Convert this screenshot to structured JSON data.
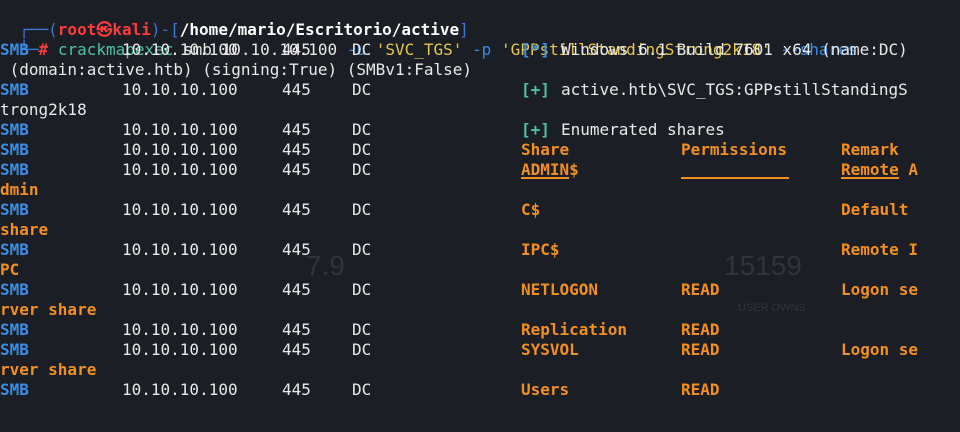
{
  "prompt": {
    "top_prefix": "┌──(",
    "user": "root",
    "skull": "㉿",
    "host": "kali",
    "sep": ")-[",
    "path": "/home/mario/Escritorio/active",
    "close": "]",
    "bottom_prefix": "└─",
    "hash": "#"
  },
  "command": {
    "binary": "crackmapexec",
    "proto": " smb 10.10.10.100 ",
    "u_flag": "-u",
    "user": "'SVC_TGS'",
    "p_flag": "-p",
    "pass": "'GPPstillStandingStrong2k18'",
    "shares_flag": "--shares"
  },
  "smb": {
    "proto": "SMB",
    "ip": "10.10.10.100",
    "port": "445",
    "host": "DC"
  },
  "lines": {
    "info_tag": "[*]",
    "info_text": "Windows 6.1 Build 7601 x64 (name:DC)",
    "info_wrap": " (domain:active.htb) (signing:True) (SMBv1:False)",
    "auth_tag": "[+]",
    "auth_text": "active.htb\\SVC_TGS:GPPstillStandingS",
    "auth_wrap": "trong2k18",
    "enum_tag": "[+]",
    "enum_text": "Enumerated shares"
  },
  "table": {
    "headers": [
      "Share",
      "Permissions",
      "Remark"
    ],
    "rows": [
      {
        "share": "ADMIN$",
        "perm": "",
        "remark": "Remote A",
        "wrap": "dmin"
      },
      {
        "share": "C$",
        "perm": "",
        "remark": "Default",
        "wrap": "share"
      },
      {
        "share": "IPC$",
        "perm": "",
        "remark": "Remote I",
        "wrap": "PC"
      },
      {
        "share": "NETLOGON",
        "perm": "READ",
        "remark": "Logon se",
        "wrap": "rver share"
      },
      {
        "share": "Replication",
        "perm": "READ",
        "remark": "",
        "wrap": ""
      },
      {
        "share": "SYSVOL",
        "perm": "READ",
        "remark": "Logon se",
        "wrap": "rver share"
      },
      {
        "share": "Users",
        "perm": "READ",
        "remark": "",
        "wrap": ""
      }
    ]
  },
  "ghost_text": {
    "number_a": "7.9",
    "number_b": "15159",
    "caption": "USER OWNS"
  }
}
